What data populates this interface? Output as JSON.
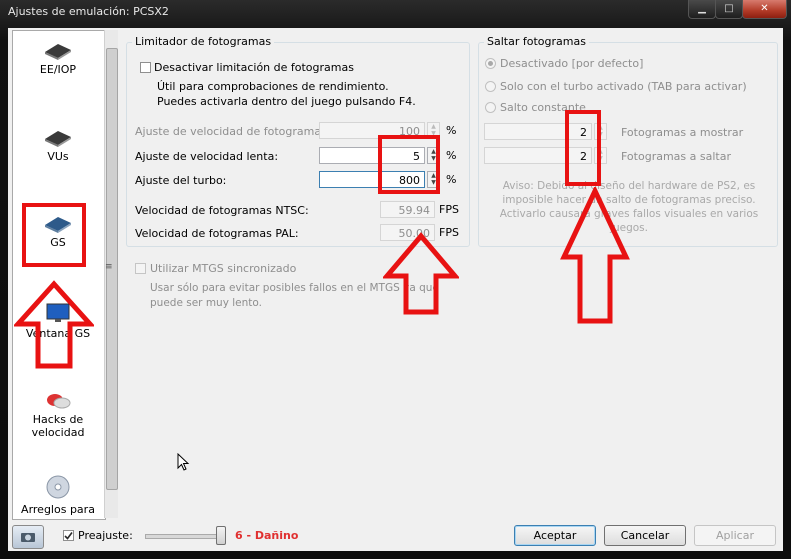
{
  "window": {
    "title": "Ajustes de emulación: PCSX2",
    "minimize": "▁",
    "maximize": "□",
    "close": "✕"
  },
  "sidebar": {
    "items": [
      {
        "label": "EE/IOP",
        "icon": "chip-icon"
      },
      {
        "label": "VUs",
        "icon": "chip-icon"
      },
      {
        "label": "GS",
        "icon": "gs-chip-icon"
      },
      {
        "label": "Ventana GS",
        "icon": "monitor-icon"
      },
      {
        "label": "Hacks de velocidad",
        "icon": "speed-hacks-icon"
      },
      {
        "label": "Arreglos para",
        "icon": "disc-icon"
      }
    ]
  },
  "frame_limiter": {
    "title": "Limitador de fotogramas",
    "disable_label": "Desactivar limitación de fotogramas",
    "disable_note": "Útil para comprobaciones de rendimiento. Puedes activarla dentro del juego pulsando F4.",
    "rows": [
      {
        "label": "Ajuste de velocidad de fotogramas:",
        "value": "100",
        "unit": "%"
      },
      {
        "label": "Ajuste de velocidad lenta:",
        "value": "5",
        "unit": "%"
      },
      {
        "label": "Ajuste del turbo:",
        "value": "800",
        "unit": "%"
      }
    ],
    "ntsc_label": "Velocidad de fotogramas NTSC:",
    "ntsc_value": "59.94",
    "pal_label": "Velocidad de fotogramas PAL:",
    "pal_value": "50.00",
    "fps_unit": "FPS"
  },
  "mtgs": {
    "label": "Utilizar MTGS sincronizado",
    "note": "Usar sólo para evitar posibles fallos en el MTGS ya que puede ser muy lento."
  },
  "frame_skip": {
    "title": "Saltar fotogramas",
    "options": [
      {
        "label": "Desactivado [por defecto]",
        "selected": true
      },
      {
        "label": "Solo con el turbo activado (TAB para activar)",
        "selected": false
      },
      {
        "label": "Salto constante",
        "selected": false
      }
    ],
    "show_value": "2",
    "show_label": "Fotogramas a mostrar",
    "skip_value": "2",
    "skip_label": "Fotogramas a saltar",
    "warning": "Aviso: Debido al diseño del hardware de PS2, es imposible hacer un salto de fotogramas preciso. Activarlo causará graves fallos visuales en varios juegos."
  },
  "footer": {
    "preset_label": "Preajuste:",
    "preset_value": "6 - Dañino",
    "preset_level": 6,
    "preset_max": 6,
    "accept": "Aceptar",
    "cancel": "Cancelar",
    "apply": "Aplicar"
  },
  "colors": {
    "annotation_red": "#e81212",
    "preset_red": "#e03030"
  }
}
